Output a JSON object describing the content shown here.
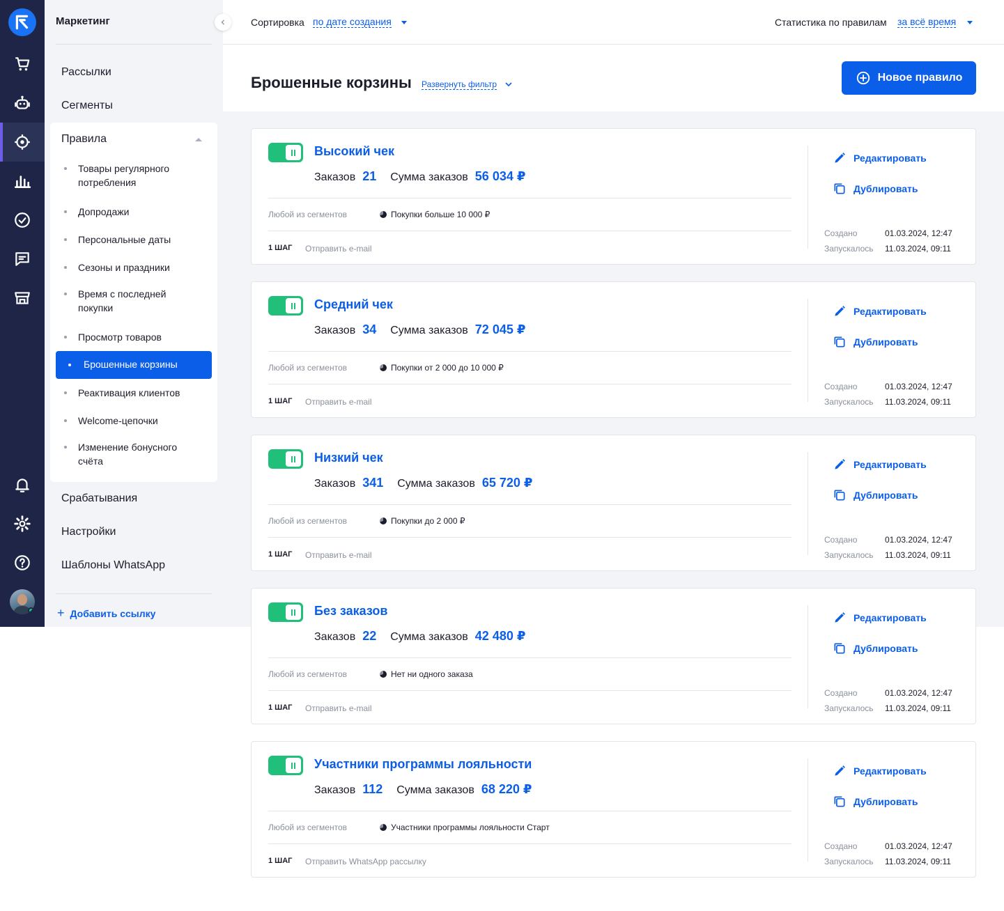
{
  "nav_rail": {
    "items": [
      "cart-icon",
      "robot-icon",
      "target-icon",
      "chart-icon",
      "check-icon",
      "chat-icon",
      "store-icon",
      "bell-icon",
      "gear-icon",
      "help-icon"
    ],
    "active": "target-icon"
  },
  "sidebar": {
    "title": "Маркетинг",
    "items_top": [
      "Рассылки",
      "Сегменты"
    ],
    "rules_label": "Правила",
    "rules_sub": [
      "Товары регулярного потребления",
      "Допродажи",
      "Персональные даты",
      "Сезоны и праздники",
      "Время с последней покупки",
      "Просмотр товаров",
      "Брошенные корзины",
      "Реактивация клиентов",
      "Welcome-цепочки",
      "Изменение бонусного счёта"
    ],
    "active_sub": "Брошенные корзины",
    "items_bottom": [
      "Срабатывания",
      "Настройки",
      "Шаблоны WhatsApp"
    ],
    "add_link": "Добавить ссылку"
  },
  "header": {
    "sort_label": "Сортировка",
    "sort_value": "по дате создания",
    "stats_label": "Статистика по правилам",
    "stats_value": "за всё время"
  },
  "page": {
    "title": "Брошенные корзины",
    "filter_link": "Развернуть фильтр",
    "new_button": "Новое правило"
  },
  "labels": {
    "orders": "Заказов",
    "sum": "Сумма заказов",
    "segments": "Любой из сегментов",
    "step": "1 ШАГ",
    "edit": "Редактировать",
    "duplicate": "Дублировать",
    "created": "Создано",
    "launched": "Запускалось"
  },
  "colors": {
    "accent": "#0b5ee8",
    "toggle_on": "#21c07a",
    "rail_bg": "#1e2547"
  },
  "rules": [
    {
      "name": "Высокий чек",
      "orders": "21",
      "sum": "56 034 ₽",
      "segment": "Покупки больше 10 000 ₽",
      "action": "Отправить e-mail",
      "created": "01.03.2024, 12:47",
      "launched": "11.03.2024, 09:11",
      "enabled": true
    },
    {
      "name": "Средний чек",
      "orders": "34",
      "sum": "72 045 ₽",
      "segment": "Покупки от 2 000 до 10 000 ₽",
      "action": "Отправить e-mail",
      "created": "01.03.2024, 12:47",
      "launched": "11.03.2024, 09:11",
      "enabled": true
    },
    {
      "name": "Низкий чек",
      "orders": "341",
      "sum": "65 720 ₽",
      "segment": "Покупки до 2 000 ₽",
      "action": "Отправить e-mail",
      "created": "01.03.2024, 12:47",
      "launched": "11.03.2024, 09:11",
      "enabled": true
    },
    {
      "name": "Без заказов",
      "orders": "22",
      "sum": "42 480 ₽",
      "segment": "Нет ни одного заказа",
      "action": "Отправить e-mail",
      "created": "01.03.2024, 12:47",
      "launched": "11.03.2024, 09:11",
      "enabled": true
    },
    {
      "name": "Участники программы лояльности",
      "orders": "112",
      "sum": "68 220 ₽",
      "segment": "Участники программы лояльности Старт",
      "action": "Отправить WhatsApp рассылку",
      "created": "01.03.2024, 12:47",
      "launched": "11.03.2024, 09:11",
      "enabled": true
    }
  ]
}
